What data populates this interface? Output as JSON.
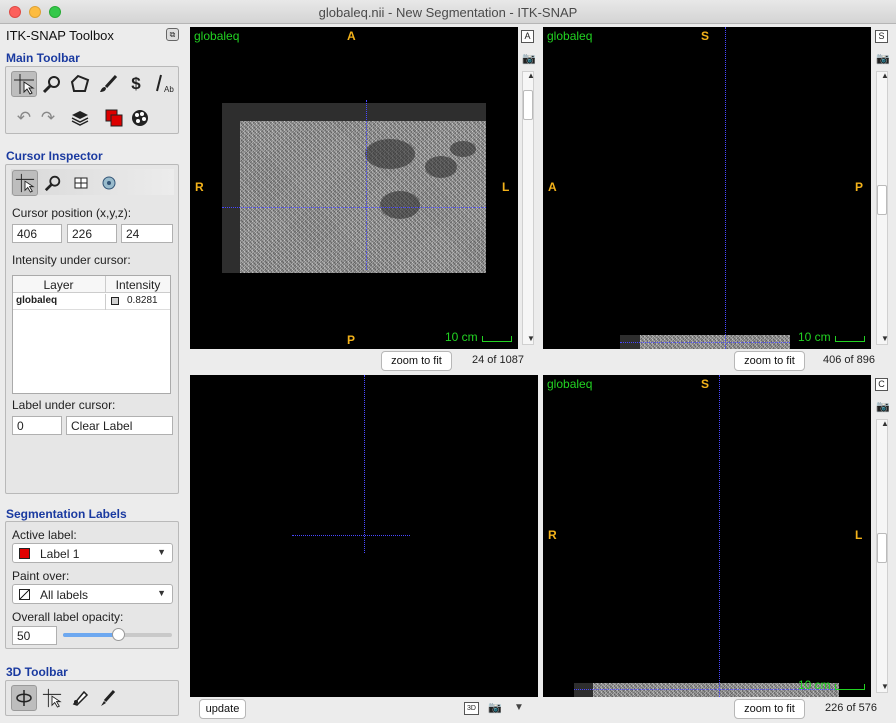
{
  "window": {
    "title": "globaleq.nii - New Segmentation - ITK-SNAP"
  },
  "toolbox": {
    "title": "ITK-SNAP Toolbox",
    "detach_icon": "detach-icon",
    "main_toolbar": {
      "title": "Main Toolbar",
      "tools": [
        "crosshair-tool-icon",
        "zoom-pan-tool-icon",
        "polygon-tool-icon",
        "paintbrush-tool-icon",
        "snake-tool-icon",
        "annotation-tool-icon"
      ],
      "actions": [
        "undo-icon",
        "redo-icon",
        "layers-icon",
        "color-labels-icon",
        "palette-icon"
      ]
    },
    "cursor_inspector": {
      "title": "Cursor Inspector",
      "position_label": "Cursor position (x,y,z):",
      "x": "406",
      "y": "226",
      "z": "24",
      "intensity_label": "Intensity under cursor:",
      "col_layer": "Layer",
      "col_intensity": "Intensity",
      "rows": [
        {
          "layer": "globaleq",
          "intensity": "0.8281"
        }
      ],
      "label_under_cursor": "Label under cursor:",
      "label_id": "0",
      "label_name": "Clear Label"
    },
    "segmentation_labels": {
      "title": "Segmentation Labels",
      "active_label_caption": "Active label:",
      "active_label": "Label 1",
      "active_label_color": "#e00000",
      "paint_over_caption": "Paint over:",
      "paint_over": "All labels",
      "opacity_caption": "Overall label opacity:",
      "opacity": "50",
      "opacity_fraction": 0.5
    },
    "toolbar_3d": {
      "title": "3D Toolbar"
    }
  },
  "views": {
    "axial": {
      "layer": "globaleq",
      "top": "A",
      "bottom": "P",
      "left": "R",
      "right": "L",
      "scale": "10 cm",
      "zoom_btn": "zoom to fit",
      "slice": "24 of 1087",
      "side_btn": "A"
    },
    "sagittal": {
      "layer": "globaleq",
      "top": "S",
      "left": "A",
      "right": "P",
      "scale": "10 cm",
      "zoom_btn": "zoom to fit",
      "slice": "406 of 896",
      "side_btn": "S"
    },
    "threed": {
      "update_btn": "update",
      "btn_3d": "3D"
    },
    "coronal": {
      "layer": "globaleq",
      "top": "S",
      "left": "R",
      "right": "L",
      "scale": "10 cm",
      "zoom_btn": "zoom to fit",
      "slice": "226 of 576",
      "side_btn": "C"
    }
  },
  "colors": {
    "accent": "#1a3aa0",
    "overlay_text": "#22d322",
    "orientation": "#f3b21a",
    "crosshair": "#4848ff"
  }
}
